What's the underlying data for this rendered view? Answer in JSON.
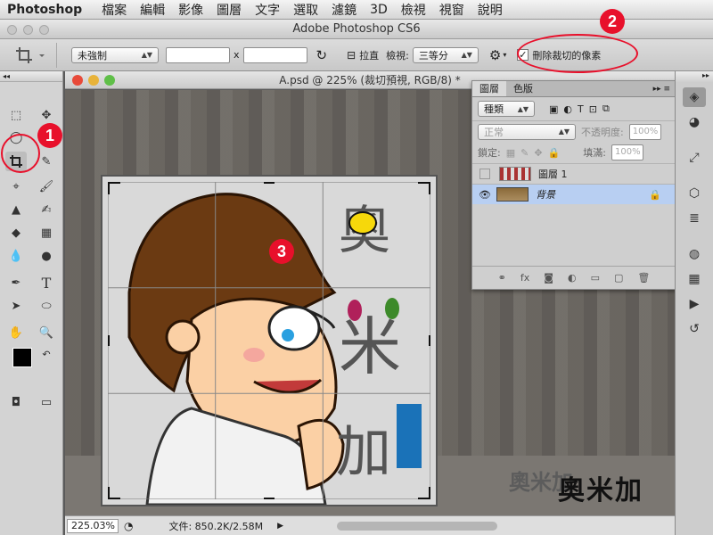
{
  "menubar": {
    "app": "Photoshop",
    "items": [
      "檔案",
      "編輯",
      "影像",
      "圖層",
      "文字",
      "選取",
      "濾鏡",
      "3D",
      "檢視",
      "視窗",
      "說明"
    ]
  },
  "window_title": "Adobe Photoshop CS6",
  "options": {
    "ratio": "未強制",
    "times": "x",
    "straighten": "拉直",
    "view_label": "檢視:",
    "view_value": "三等分",
    "delete_cropped": "刪除裁切的像素",
    "delete_cropped_checked": "✓"
  },
  "document": {
    "title": "A.psd @ 225% (裁切預視, RGB/8) *",
    "zoom": "225.03%",
    "file_info": "文件: 850.2K/2.58M"
  },
  "layers_panel": {
    "tabs": [
      "圖層",
      "色版"
    ],
    "filter": "種類",
    "blend": "正常",
    "opacity_label": "不透明度:",
    "opacity": "100%",
    "lock_label": "鎖定:",
    "fill_label": "填滿:",
    "fill": "100%",
    "layers": [
      {
        "name": "圖層 1"
      },
      {
        "name": "背景"
      }
    ]
  },
  "annotations": [
    "1",
    "2",
    "3"
  ],
  "watermark": "奧米加",
  "logo_text": "奧米加",
  "colors": {
    "accent_red": "#e8102b",
    "selection": "#b8cff2"
  }
}
